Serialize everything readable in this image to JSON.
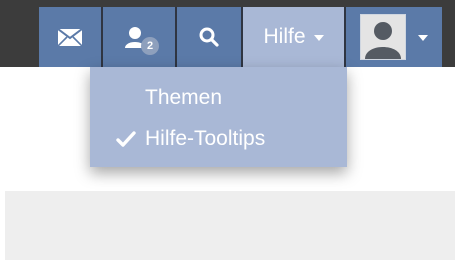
{
  "navbar": {
    "mail_icon": "envelope-icon",
    "users_icon": "user-icon",
    "users_badge": "2",
    "search_icon": "search-icon",
    "help_label": "Hilfe",
    "profile_icon": "avatar-icon"
  },
  "help_menu": {
    "items": [
      {
        "label": "Themen",
        "checked": false
      },
      {
        "label": "Hilfe-Tooltips",
        "checked": true
      }
    ]
  },
  "colors": {
    "nav_button": "#5b7aa8",
    "nav_active": "#a9b8d6",
    "navbar_bg": "#3c3c3c",
    "content_band": "#eeeeee"
  }
}
